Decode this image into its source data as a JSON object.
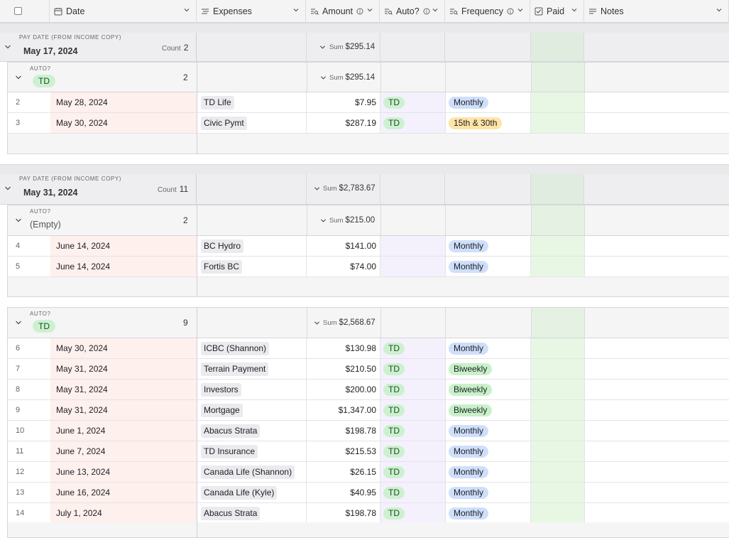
{
  "columns": {
    "date": "Date",
    "expenses": "Expenses",
    "amount": "Amount",
    "auto": "Auto?",
    "frequency": "Frequency",
    "paid": "Paid",
    "notes": "Notes"
  },
  "colors": {
    "date_bg": "#fdf0ed",
    "auto_bg": "#f4f1fd",
    "paid_bg": "#e7f7e3",
    "td_pill": "#cdf1d0",
    "monthly_pill": "#cfdffb",
    "biweekly_pill": "#c9f1c9",
    "semimonthly_pill": "#ffe4a8"
  },
  "groups": [
    {
      "field_label": "PAY DATE (FROM INCOME COPY)",
      "title": "May 17, 2024",
      "count_label": "Count",
      "count": "2",
      "sum_label": "Sum",
      "sum": "$295.14",
      "subgroups": [
        {
          "field_label": "AUTO?",
          "value": "TD",
          "count": "2",
          "sum_label": "Sum",
          "sum": "$295.14",
          "rows": [
            {
              "n": "2",
              "date": "May 28, 2024",
              "expense": "TD Life",
              "amount": "$7.95",
              "auto": "TD",
              "freq": "Monthly"
            },
            {
              "n": "3",
              "date": "May 30, 2024",
              "expense": "Civic Pymt",
              "amount": "$287.19",
              "auto": "TD",
              "freq": "15th & 30th"
            }
          ]
        }
      ]
    },
    {
      "field_label": "PAY DATE (FROM INCOME COPY)",
      "title": "May 31, 2024",
      "count_label": "Count",
      "count": "11",
      "sum_label": "Sum",
      "sum": "$2,783.67",
      "subgroups": [
        {
          "field_label": "AUTO?",
          "value": "(Empty)",
          "count": "2",
          "sum_label": "Sum",
          "sum": "$215.00",
          "rows": [
            {
              "n": "4",
              "date": "June 14, 2024",
              "expense": "BC Hydro",
              "amount": "$141.00",
              "auto": "",
              "freq": "Monthly"
            },
            {
              "n": "5",
              "date": "June 14, 2024",
              "expense": "Fortis BC",
              "amount": "$74.00",
              "auto": "",
              "freq": "Monthly"
            }
          ]
        },
        {
          "field_label": "AUTO?",
          "value": "TD",
          "count": "9",
          "sum_label": "Sum",
          "sum": "$2,568.67",
          "rows": [
            {
              "n": "6",
              "date": "May 30, 2024",
              "expense": "ICBC (Shannon)",
              "amount": "$130.98",
              "auto": "TD",
              "freq": "Monthly"
            },
            {
              "n": "7",
              "date": "May 31, 2024",
              "expense": "Terrain Payment",
              "amount": "$210.50",
              "auto": "TD",
              "freq": "Biweekly"
            },
            {
              "n": "8",
              "date": "May 31, 2024",
              "expense": "Investors",
              "amount": "$200.00",
              "auto": "TD",
              "freq": "Biweekly"
            },
            {
              "n": "9",
              "date": "May 31, 2024",
              "expense": "Mortgage",
              "amount": "$1,347.00",
              "auto": "TD",
              "freq": "Biweekly"
            },
            {
              "n": "10",
              "date": "June 1, 2024",
              "expense": "Abacus Strata",
              "amount": "$198.78",
              "auto": "TD",
              "freq": "Monthly"
            },
            {
              "n": "11",
              "date": "June 7, 2024",
              "expense": "TD Insurance",
              "amount": "$215.53",
              "auto": "TD",
              "freq": "Monthly"
            },
            {
              "n": "12",
              "date": "June 13, 2024",
              "expense": "Canada Life (Shannon)",
              "amount": "$26.15",
              "auto": "TD",
              "freq": "Monthly"
            },
            {
              "n": "13",
              "date": "June 16, 2024",
              "expense": "Canada Life (Kyle)",
              "amount": "$40.95",
              "auto": "TD",
              "freq": "Monthly"
            },
            {
              "n": "14",
              "date": "July 1, 2024",
              "expense": "Abacus Strata",
              "amount": "$198.78",
              "auto": "TD",
              "freq": "Monthly"
            }
          ]
        }
      ]
    }
  ]
}
